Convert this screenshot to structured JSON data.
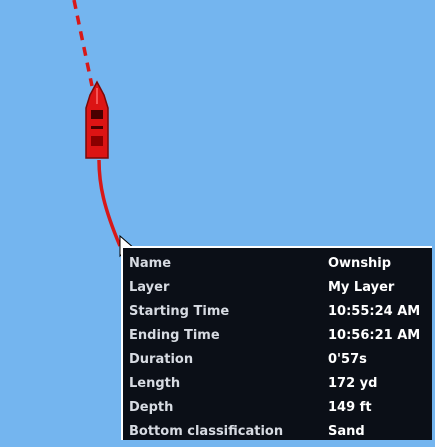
{
  "map": {
    "background_color": "#74b5ef",
    "track_color": "#d81818",
    "vessel_color": "#dc1414",
    "vessel_icon": "boat-icon",
    "cursor_icon": "pointer-cursor-icon"
  },
  "info_panel": {
    "rows": [
      {
        "label": "Name",
        "value": "Ownship"
      },
      {
        "label": "Layer",
        "value": "My Layer"
      },
      {
        "label": "Starting Time",
        "value": "10:55:24 AM"
      },
      {
        "label": "Ending Time",
        "value": "10:56:21 AM"
      },
      {
        "label": "Duration",
        "value": "0'57s"
      },
      {
        "label": "Length",
        "value": "172 yd"
      },
      {
        "label": "Depth",
        "value": "149 ft"
      },
      {
        "label": "Bottom classification",
        "value": "Sand"
      }
    ]
  }
}
